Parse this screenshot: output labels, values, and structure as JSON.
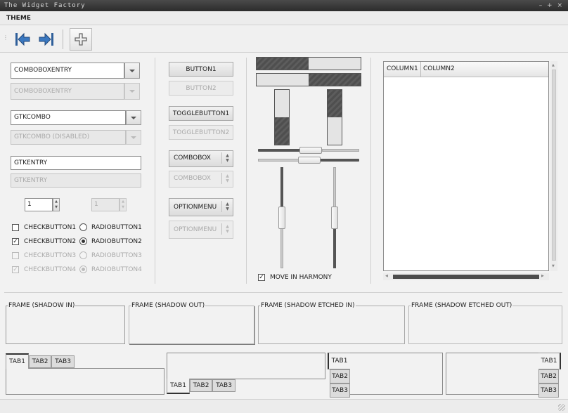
{
  "window": {
    "title": "The Widget Factory",
    "controls": "– + ×"
  },
  "menubar": {
    "items": [
      "THEME"
    ]
  },
  "toolbar": {
    "buttons": [
      {
        "icon": "go-first-icon"
      },
      {
        "icon": "go-last-icon"
      },
      {
        "icon": "add-icon"
      }
    ]
  },
  "left": {
    "comboboxentry": {
      "value": "COMBOBOXENTRY",
      "disabled_value": "COMBOBOXENTRY"
    },
    "gtkcombo": {
      "value": "GTKCOMBO",
      "disabled_value": "GTKCOMBO (DISABLED)"
    },
    "gtkentry": {
      "value": "GTKENTRY",
      "disabled_value": "GTKENTRY"
    },
    "spin": {
      "value": "1",
      "disabled_value": "1"
    },
    "checks": [
      "CHECKBUTTON1",
      "CHECKBUTTON2",
      "CHECKBUTTON3",
      "CHECKBUTTON4"
    ],
    "radios": [
      "RADIOBUTTON1",
      "RADIOBUTTON2",
      "RADIOBUTTON3",
      "RADIOBUTTON4"
    ]
  },
  "middle": {
    "button1": "BUTTON1",
    "button2": "BUTTON2",
    "toggle1": "TOGGLEBUTTON1",
    "toggle2": "TOGGLEBUTTON2",
    "combobox": "COMBOBOX",
    "combobox_dis": "COMBOBOX",
    "optionmenu": "OPTIONMENU",
    "optionmenu_dis": "OPTIONMENU"
  },
  "ranges": {
    "progress_h": [
      0.5,
      0.5
    ],
    "progress_v": [
      0.5,
      0.5
    ],
    "move_in_harmony": "MOVE IN HARMONY"
  },
  "tree": {
    "columns": [
      "COLUMN1",
      "COLUMN2"
    ]
  },
  "frames": [
    "FRAME (SHADOW IN)",
    "FRAME (SHADOW OUT)",
    "FRAME (SHADOW ETCHED IN)",
    "FRAME (SHADOW ETCHED OUT)"
  ],
  "notebooks": {
    "tabs": [
      "TAB1",
      "TAB2",
      "TAB3"
    ]
  }
}
